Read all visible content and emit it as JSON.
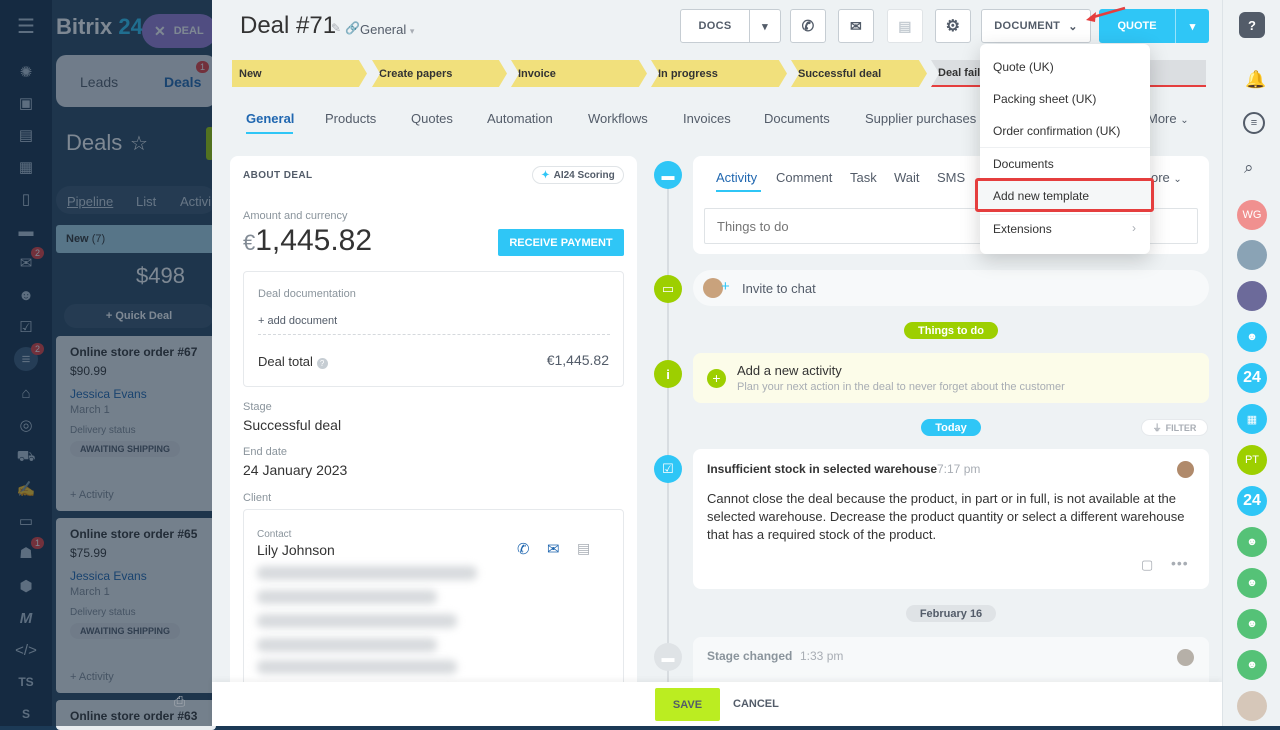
{
  "app": {
    "brand": "Bitrix",
    "brand_num": "24",
    "deal_chip": "DEAL"
  },
  "crm": {
    "tab_leads": "Leads",
    "tab_deals": "Deals",
    "deals_badge": "1",
    "title": "Deals",
    "view_pipeline": "Pipeline",
    "view_list": "List",
    "view_activity": "Activi",
    "column_name": "New",
    "column_count": "(7)",
    "column_sum": "$498",
    "quick_deal": "Quick Deal",
    "items": [
      {
        "title": "Online store order #67",
        "price": "$90.99",
        "contact": "Jessica Evans",
        "date": "March 1",
        "status_label": "Delivery status",
        "status": "AWAITING SHIPPING",
        "activity": "+ Activity"
      },
      {
        "title": "Online store order #65",
        "price": "$75.99",
        "contact": "Jessica Evans",
        "date": "March 1",
        "status_label": "Delivery status",
        "status": "AWAITING SHIPPING",
        "activity": "+ Activity"
      },
      {
        "title": "Online store order #63"
      }
    ]
  },
  "leftnav": {
    "badge_mail": "2",
    "badge_filter": "2",
    "badge_robot": "1",
    "ts": "TS",
    "s": "S"
  },
  "deal": {
    "title": "Deal #71",
    "category": "General"
  },
  "toolbar": {
    "docs": "DOCS",
    "document": "DOCUMENT",
    "quote": "QUOTE"
  },
  "stages": [
    "New",
    "Create papers",
    "Invoice",
    "In progress",
    "Successful deal",
    "Deal fail"
  ],
  "tabs": [
    "General",
    "Products",
    "Quotes",
    "Automation",
    "Workflows",
    "Invoices",
    "Documents",
    "Supplier purchases",
    "More"
  ],
  "about": {
    "header": "ABOUT DEAL",
    "scoring": "AI24 Scoring",
    "amount_label": "Amount and currency",
    "currency": "€",
    "amount": "1,445.82",
    "receive": "RECEIVE PAYMENT",
    "doc_label": "Deal documentation",
    "add_doc": "+ add document",
    "total_label": "Deal total",
    "total": "€1,445.82",
    "stage_label": "Stage",
    "stage": "Successful deal",
    "end_label": "End date",
    "end": "24 January 2023",
    "client_label": "Client",
    "contact_label": "Contact",
    "contact": "Lily Johnson"
  },
  "activity": {
    "tabs": [
      "Activity",
      "Comment",
      "Task",
      "Wait",
      "SMS",
      "ore"
    ],
    "placeholder": "Things to do",
    "invite": "Invite to chat",
    "things_pill": "Things to do",
    "new_title": "Add a new activity",
    "new_sub": "Plan your next action in the deal to never forget about the customer",
    "today": "Today",
    "filter": "FILTER",
    "warn_title": "Insufficient stock in selected warehouse",
    "warn_time": "7:17 pm",
    "warn_body": "Cannot close the deal because the product, in part or in full, is not available at the selected warehouse. Decrease the product quantity or select a different warehouse that has a required stock of the product.",
    "date2": "February 16",
    "stage_changed": "Stage changed",
    "stage_time": "1:33 pm"
  },
  "menu": {
    "items": [
      "Quote (UK)",
      "Packing sheet (UK)",
      "Order confirmation (UK)",
      "Documents",
      "Add new template",
      "Extensions"
    ],
    "highlight_color": "#e53e3e"
  },
  "footer": {
    "save": "SAVE",
    "cancel": "CANCEL"
  },
  "right": {
    "wg": "WG",
    "pt": "PT",
    "n24": "24"
  },
  "colors": {
    "accent": "#2fc6f6",
    "green": "#9dcf00",
    "stage": "#f1e07c"
  }
}
